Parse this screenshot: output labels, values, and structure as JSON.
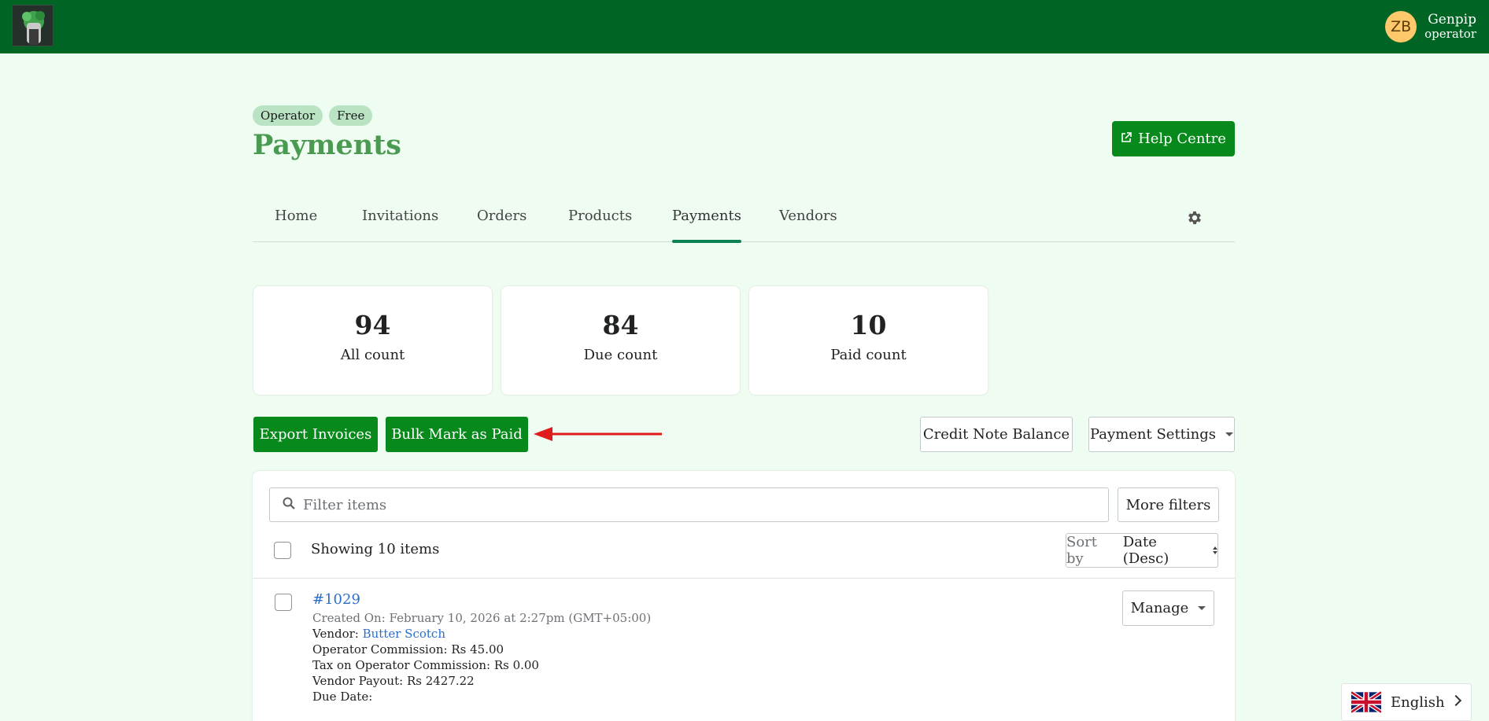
{
  "topbar": {
    "user": {
      "initials": "ZB",
      "name": "Genpip",
      "role": "operator"
    }
  },
  "header": {
    "badges": [
      "Operator",
      "Free"
    ],
    "title": "Payments",
    "help_button": "Help Centre"
  },
  "tabs": [
    {
      "label": "Home"
    },
    {
      "label": "Invitations"
    },
    {
      "label": "Orders"
    },
    {
      "label": "Products"
    },
    {
      "label": "Payments",
      "active": true
    },
    {
      "label": "Vendors"
    }
  ],
  "stats": [
    {
      "value": "94",
      "label": "All count"
    },
    {
      "value": "84",
      "label": "Due count"
    },
    {
      "value": "10",
      "label": "Paid count"
    }
  ],
  "actions": {
    "export": "Export Invoices",
    "bulk_paid": "Bulk Mark as Paid",
    "credit_note": "Credit Note Balance",
    "payment_settings": "Payment Settings"
  },
  "list": {
    "search_placeholder": "Filter items",
    "more_filters": "More filters",
    "showing": "Showing 10 items",
    "sort_prefix": "Sort by",
    "sort_value": "Date (Desc)"
  },
  "orders": [
    {
      "id": "#1029",
      "created": "Created On: February 10, 2026 at 2:27pm (GMT+05:00)",
      "vendor_label": "Vendor: ",
      "vendor_name": "Butter Scotch",
      "operator_commission": "Operator Commission: Rs 45.00",
      "tax": "Tax on Operator Commission: Rs 0.00",
      "vendor_payout": "Vendor Payout: Rs 2427.22",
      "due_date": "Due Date:",
      "manage": "Manage"
    }
  ],
  "language": {
    "label": "English"
  },
  "colors": {
    "topbar": "#006524",
    "primary": "#078a1b",
    "title": "#4a9a51",
    "annotation_arrow": "#e01b1b"
  }
}
